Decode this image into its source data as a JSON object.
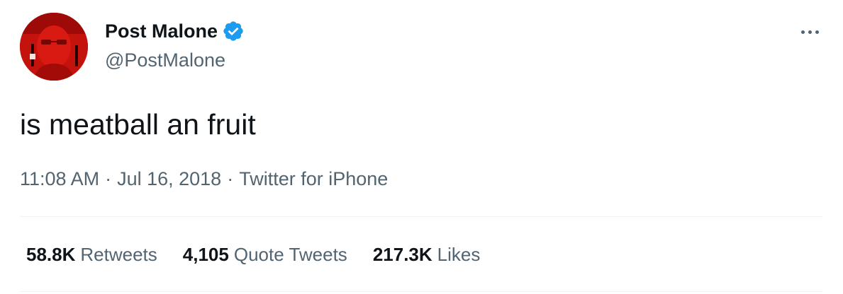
{
  "author": {
    "display_name": "Post Malone",
    "handle": "@PostMalone",
    "verified": true,
    "avatar_icon": "profile-photo",
    "avatar_color": "#c0100c"
  },
  "more_icon": "more-horizontal-icon",
  "tweet": {
    "text": "is meatball an fruit"
  },
  "meta": {
    "time": "11:08 AM",
    "separator": "·",
    "date": "Jul 16, 2018",
    "source": "Twitter for iPhone"
  },
  "stats": [
    {
      "value": "58.8K",
      "label": "Retweets"
    },
    {
      "value": "4,105",
      "label": "Quote Tweets"
    },
    {
      "value": "217.3K",
      "label": "Likes"
    }
  ],
  "colors": {
    "text_primary": "#0f1419",
    "text_secondary": "#536471",
    "verified_blue": "#1d9bf0",
    "divider": "#eff3f4"
  }
}
